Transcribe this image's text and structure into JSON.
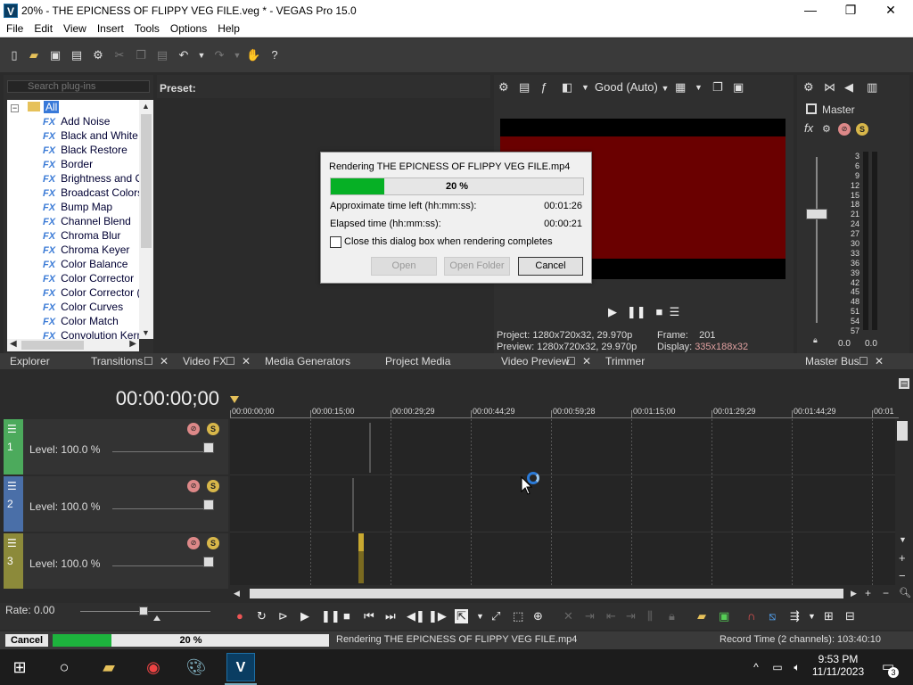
{
  "window": {
    "title": "20% - THE EPICNESS OF FLIPPY VEG FILE.veg * - VEGAS Pro 15.0",
    "logo": "V",
    "minimize": "—",
    "maximize": "❐",
    "close": "✕"
  },
  "menu": [
    "File",
    "Edit",
    "View",
    "Insert",
    "Tools",
    "Options",
    "Help"
  ],
  "explorer": {
    "search_placeholder": "Search plug-ins",
    "root": "All",
    "items": [
      "Add Noise",
      "Black and White",
      "Black Restore",
      "Border",
      "Brightness and Co",
      "Broadcast Colors",
      "Bump Map",
      "Channel Blend",
      "Chroma Blur",
      "Chroma Keyer",
      "Color Balance",
      "Color Corrector",
      "Color Corrector (S",
      "Color Curves",
      "Color Match",
      "Convolution Kerne"
    ],
    "fx_label": "FX"
  },
  "preset": {
    "label": "Preset:"
  },
  "preview": {
    "quality": "Good (Auto)",
    "project_label": "Project:",
    "project_value": "1280x720x32, 29.970p",
    "frame_label": "Frame:",
    "frame_value": "201",
    "preview_label": "Preview:",
    "preview_value": "1280x720x32, 29.970p",
    "display_label": "Display:",
    "display_value": "335x188x32"
  },
  "master": {
    "title": "Master",
    "scale": [
      "3",
      "6",
      "9",
      "12",
      "15",
      "18",
      "21",
      "24",
      "27",
      "30",
      "33",
      "36",
      "39",
      "42",
      "45",
      "48",
      "51",
      "54",
      "57"
    ],
    "left_value": "0.0",
    "right_value": "0.0"
  },
  "tabs": {
    "explorer": "Explorer",
    "transitions": "Transitions",
    "video_fx": "Video FX",
    "media_generators": "Media Generators",
    "project_media": "Project Media",
    "video_preview": "Video Preview",
    "trimmer": "Trimmer",
    "master_bus": "Master Bus"
  },
  "timeline": {
    "timecode": "00:00:00;00",
    "ruler": [
      "00:00:00;00",
      "00:00:15;00",
      "00:00:29;29",
      "00:00:44;29",
      "00:00:59;28",
      "00:01:15;00",
      "00:01:29;29",
      "00:01:44;29",
      "00:01"
    ],
    "tracks": [
      {
        "num": "1",
        "level": "Level: 100.0 %",
        "color": "#4caa5c"
      },
      {
        "num": "2",
        "level": "Level: 100.0 %",
        "color": "#4a6fa8"
      },
      {
        "num": "3",
        "level": "Level: 100.0 %",
        "color": "#8c8a3a"
      }
    ]
  },
  "transport": {
    "rate": "Rate: 0.00"
  },
  "status": {
    "cancel": "Cancel",
    "progress_percent": 20,
    "progress_label": "20 %",
    "rendering": "Rendering THE EPICNESS OF FLIPPY VEG FILE.mp4",
    "record_time": "Record Time (2 channels): 103:40:10"
  },
  "dialog": {
    "title": "Rendering THE EPICNESS OF FLIPPY VEG FILE.mp4",
    "progress_label": "20 %",
    "time_left_label": "Approximate time left (hh:mm:ss):",
    "time_left_value": "00:01:26",
    "elapsed_label": "Elapsed time (hh:mm:ss):",
    "elapsed_value": "00:00:21",
    "checkbox_label": "Close this dialog box when rendering completes",
    "open": "Open",
    "open_folder": "Open Folder",
    "cancel": "Cancel"
  },
  "taskbar": {
    "time": "9:53 PM",
    "date": "11/11/2023",
    "notifications": "3"
  }
}
